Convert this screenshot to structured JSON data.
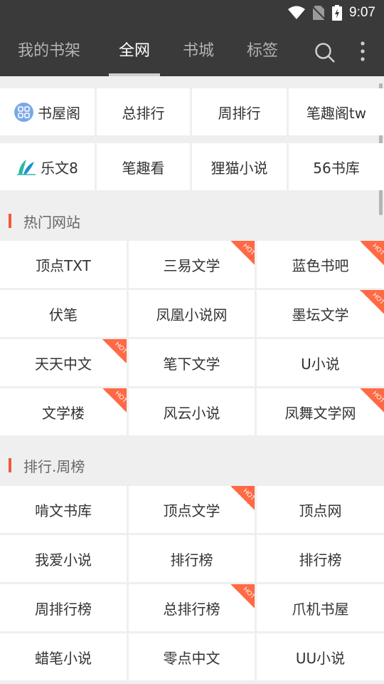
{
  "status": {
    "time": "9:07"
  },
  "tabs": [
    {
      "label": "我的书架"
    },
    {
      "label": "全网"
    },
    {
      "label": "书城"
    },
    {
      "label": "标签"
    }
  ],
  "quick_links": [
    {
      "label": "书屋阁",
      "icon": "grid-badge-icon"
    },
    {
      "label": "总排行"
    },
    {
      "label": "周排行"
    },
    {
      "label": "笔趣阁tw"
    },
    {
      "label": "乐文8",
      "icon": "feather-logo-icon"
    },
    {
      "label": "笔趣看"
    },
    {
      "label": "狸猫小说"
    },
    {
      "label": "56书库"
    }
  ],
  "section_hot": {
    "title": "热门网站",
    "items": [
      {
        "label": "顶点TXT",
        "hot": false
      },
      {
        "label": "三易文学",
        "hot": true
      },
      {
        "label": "蓝色书吧",
        "hot": true
      },
      {
        "label": "伏笔",
        "hot": false
      },
      {
        "label": "凤凰小说网",
        "hot": false
      },
      {
        "label": "墨坛文学",
        "hot": true
      },
      {
        "label": "天天中文",
        "hot": true
      },
      {
        "label": "笔下文学",
        "hot": false
      },
      {
        "label": "U小说",
        "hot": false
      },
      {
        "label": "文学楼",
        "hot": true
      },
      {
        "label": "风云小说",
        "hot": false
      },
      {
        "label": "凤舞文学网",
        "hot": true
      }
    ]
  },
  "section_rank": {
    "title": "排行.周榜",
    "items": [
      {
        "label": "啃文书库",
        "hot": false
      },
      {
        "label": "顶点文学",
        "hot": true
      },
      {
        "label": "顶点网",
        "hot": false
      },
      {
        "label": "我爱小说",
        "hot": false
      },
      {
        "label": "排行榜",
        "hot": false
      },
      {
        "label": "排行榜",
        "hot": false
      },
      {
        "label": "周排行榜",
        "hot": false
      },
      {
        "label": "总排行榜",
        "hot": true
      },
      {
        "label": "爪机书屋",
        "hot": false
      },
      {
        "label": "蜡笔小说",
        "hot": false
      },
      {
        "label": "零点中文",
        "hot": false
      },
      {
        "label": "UU小说",
        "hot": false
      }
    ]
  },
  "hot_badge": "HOT",
  "colors": {
    "appbar": "#3a3a3a",
    "accent": "#f05a3c",
    "hot": "#ff6a45"
  }
}
